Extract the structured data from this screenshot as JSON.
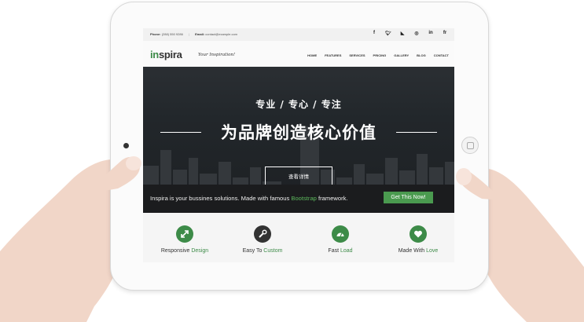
{
  "topbar": {
    "phone_label": "Phone:",
    "phone": "(288) 550 9286",
    "email_label": "Email:",
    "email": "contact@example.com",
    "socials": [
      "f",
      "t",
      "rss",
      "p",
      "in",
      "fr"
    ]
  },
  "brand": {
    "logo_accent": "in",
    "logo_rest": "spira",
    "tagline": "Your Inspiration!"
  },
  "nav": [
    "HOME",
    "FEATURES",
    "SERVICES",
    "PRICING",
    "GALLERY",
    "BLOG",
    "CONTACT"
  ],
  "hero": {
    "subtitle": "专业 / 专心 / 专注",
    "title": "为品牌创造核心价值",
    "button": "查看详情"
  },
  "promo": {
    "text_before": "Inspira is your bussines solutions. Made with famous ",
    "text_link": "Bootstrap",
    "text_after": " framework.",
    "cta": "Get This Now!"
  },
  "features": [
    {
      "label": "Responsive ",
      "highlight": "Design",
      "icon": "resize-arrows-icon",
      "color": "#3d8b48"
    },
    {
      "label": "Easy To ",
      "highlight": "Custom",
      "icon": "wrench-icon",
      "color": "#333333"
    },
    {
      "label": "Fast ",
      "highlight": "Load",
      "icon": "speedometer-icon",
      "color": "#3d8b48"
    },
    {
      "label": "Made With ",
      "highlight": "Love",
      "icon": "heart-icon",
      "color": "#3d8b48"
    }
  ],
  "colors": {
    "accent": "#3d8b48",
    "hero_bg": "#22272b",
    "promo_bg": "#1b1c1e"
  }
}
